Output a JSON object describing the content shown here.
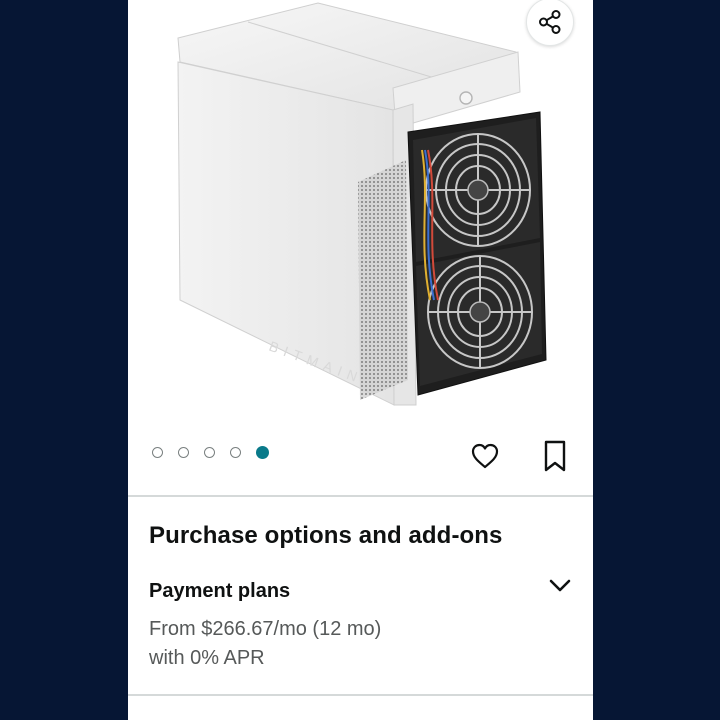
{
  "product": {
    "image_icon": "antminer-product-photo",
    "brand_text": "BITMAIN"
  },
  "carousel": {
    "total": 5,
    "active_index": 4
  },
  "icons": {
    "share": "share-icon",
    "wishlist": "heart-icon",
    "save": "bookmark-icon",
    "expand": "chevron-down-icon"
  },
  "purchase": {
    "title": "Purchase options and add-ons",
    "payment_plans": {
      "label": "Payment plans",
      "line1": "From $266.67/mo (12 mo)",
      "line2": "with 0% APR"
    }
  },
  "colors": {
    "background": "#061634",
    "accent": "#097a8a",
    "text": "#0f1111",
    "muted": "#565959"
  }
}
